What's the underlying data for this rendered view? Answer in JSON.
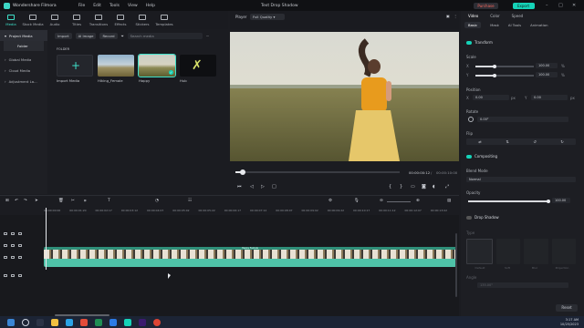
{
  "app": {
    "name": "Wondershare Filmora",
    "menu": [
      "File",
      "Edit",
      "Tools",
      "View",
      "Help"
    ],
    "project_title": "Text Drop Shadow",
    "purchase": "Purchase",
    "export": "Export"
  },
  "media_tabs": [
    {
      "label": "Media",
      "active": true
    },
    {
      "label": "Stock Media"
    },
    {
      "label": "Audio"
    },
    {
      "label": "Titles"
    },
    {
      "label": "Transitions"
    },
    {
      "label": "Effects"
    },
    {
      "label": "Stickers"
    },
    {
      "label": "Templates"
    }
  ],
  "left_nav": {
    "project_media": "Project Media",
    "folder": "Folder",
    "global_media": "Global Media",
    "cloud_media": "Cloud Media",
    "adjustment": "Adjustment La..."
  },
  "media_toolbar": {
    "import": "Import",
    "ai_image": "AI Image",
    "record": "Record",
    "search_placeholder": "Search media"
  },
  "media": {
    "folder_label": "FOLDER",
    "items": [
      {
        "name": "Import Media"
      },
      {
        "name": "Hiking_Female"
      },
      {
        "name": "Happy"
      },
      {
        "name": "Hub"
      }
    ]
  },
  "player": {
    "label": "Player",
    "quality": "Full Quality",
    "current_time": "00:00:00:12",
    "total_time": "00:00:10:00",
    "progress": 0.04
  },
  "properties": {
    "tabs": [
      "Video",
      "Color",
      "Speed"
    ],
    "subtabs": [
      "Basic",
      "Mask",
      "AI Tools",
      "Animation"
    ],
    "transform": "Transform",
    "scale": "Scale",
    "scale_x": "100.00",
    "scale_y": "100.00",
    "scale_x_label": "X",
    "scale_y_label": "Y",
    "unit_pct": "%",
    "position": "Position",
    "pos_x": "0.00",
    "pos_y": "0.00",
    "pos_x_label": "X",
    "pos_y_label": "Y",
    "unit_px": "px",
    "rotate": "Rotate",
    "rotate_val": "0.00°",
    "flip": "Flip",
    "compositing": "Compositing",
    "blend_mode": "Blend Mode",
    "blend_val": "Normal",
    "opacity": "Opacity",
    "opacity_val": "100.00",
    "drop_shadow": "Drop Shadow",
    "type": "Type",
    "presets": [
      "Default",
      "Soft",
      "Blur",
      "Projection"
    ],
    "angle": "Angle",
    "angle_val": "135.00°",
    "reset": "Reset"
  },
  "timeline": {
    "ruler": [
      "00:00:00:00",
      "00:00:01:20",
      "00:00:02:17",
      "00:00:03:12",
      "00:00:04:07",
      "00:00:05:02",
      "00:00:05:22",
      "00:00:06:17",
      "00:00:07:12",
      "00:00:08:07",
      "00:00:09:02",
      "00:00:09:22",
      "00:00:10:17",
      "00:00:11:12",
      "00:00:12:07",
      "00:00:13:02"
    ],
    "clip_title": "Happy Female"
  },
  "taskbar": {
    "time": "3:17 AM",
    "date": "10/25/2023"
  }
}
